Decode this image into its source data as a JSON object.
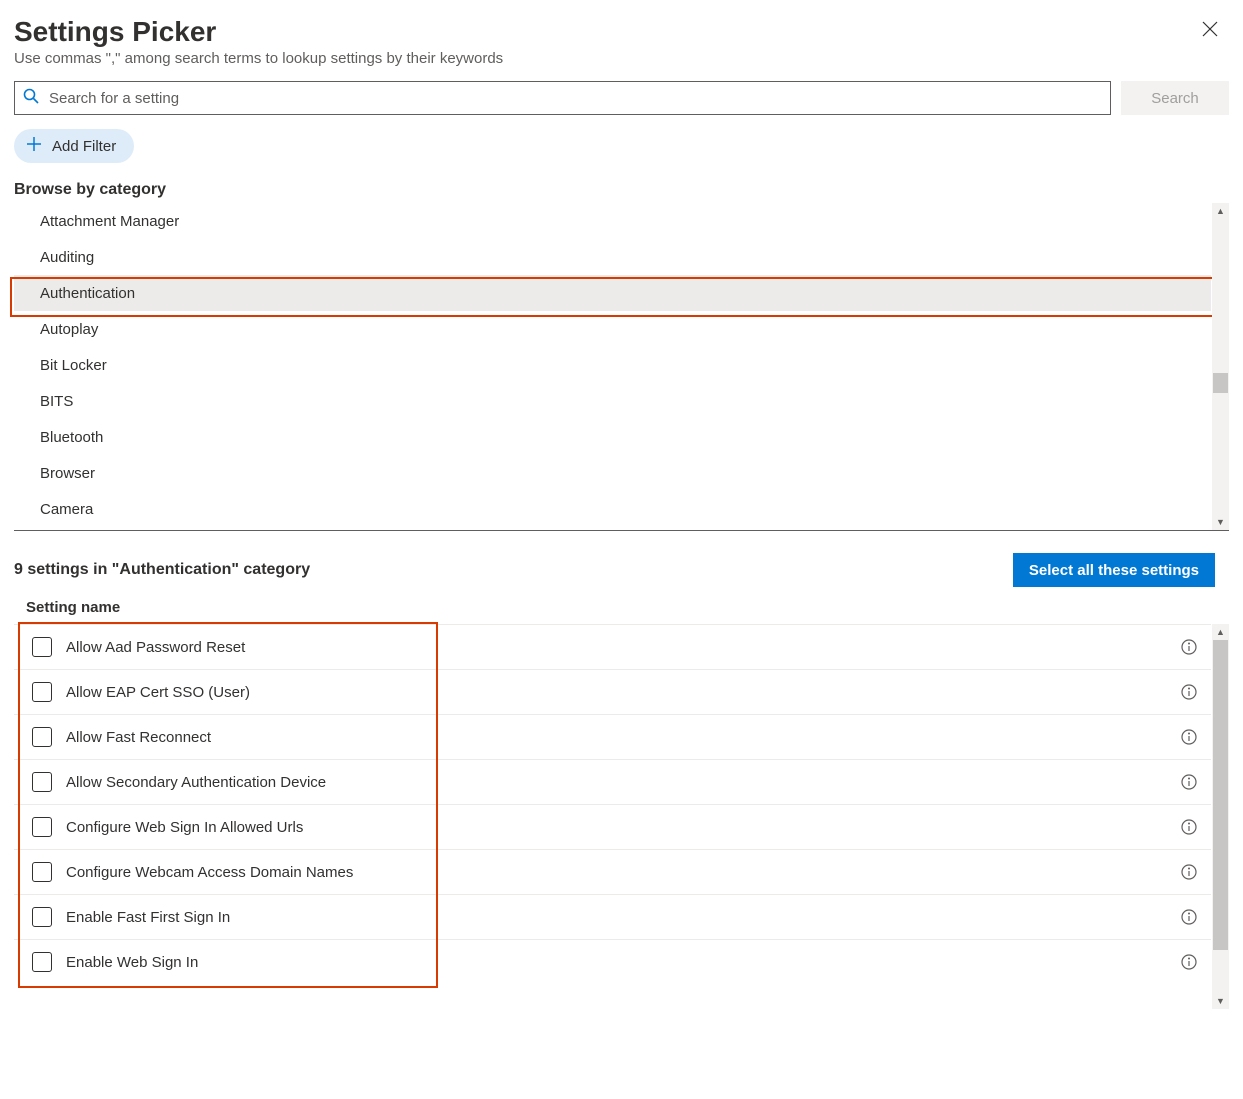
{
  "header": {
    "title": "Settings Picker",
    "subtitle": "Use commas \",\" among search terms to lookup settings by their keywords"
  },
  "search": {
    "placeholder": "Search for a setting",
    "button": "Search"
  },
  "filter": {
    "add_label": "Add Filter"
  },
  "browse": {
    "label": "Browse by category",
    "categories": [
      "Attachment Manager",
      "Auditing",
      "Authentication",
      "Autoplay",
      "Bit Locker",
      "BITS",
      "Bluetooth",
      "Browser",
      "Camera"
    ],
    "selected_index": 2
  },
  "results": {
    "summary": "9 settings in \"Authentication\" category",
    "select_all": "Select all these settings",
    "column_header": "Setting name",
    "settings": [
      "Allow Aad Password Reset",
      "Allow EAP Cert SSO (User)",
      "Allow Fast Reconnect",
      "Allow Secondary Authentication Device",
      "Configure Web Sign In Allowed Urls",
      "Configure Webcam Access Domain Names",
      "Enable Fast First Sign In",
      "Enable Web Sign In"
    ]
  }
}
